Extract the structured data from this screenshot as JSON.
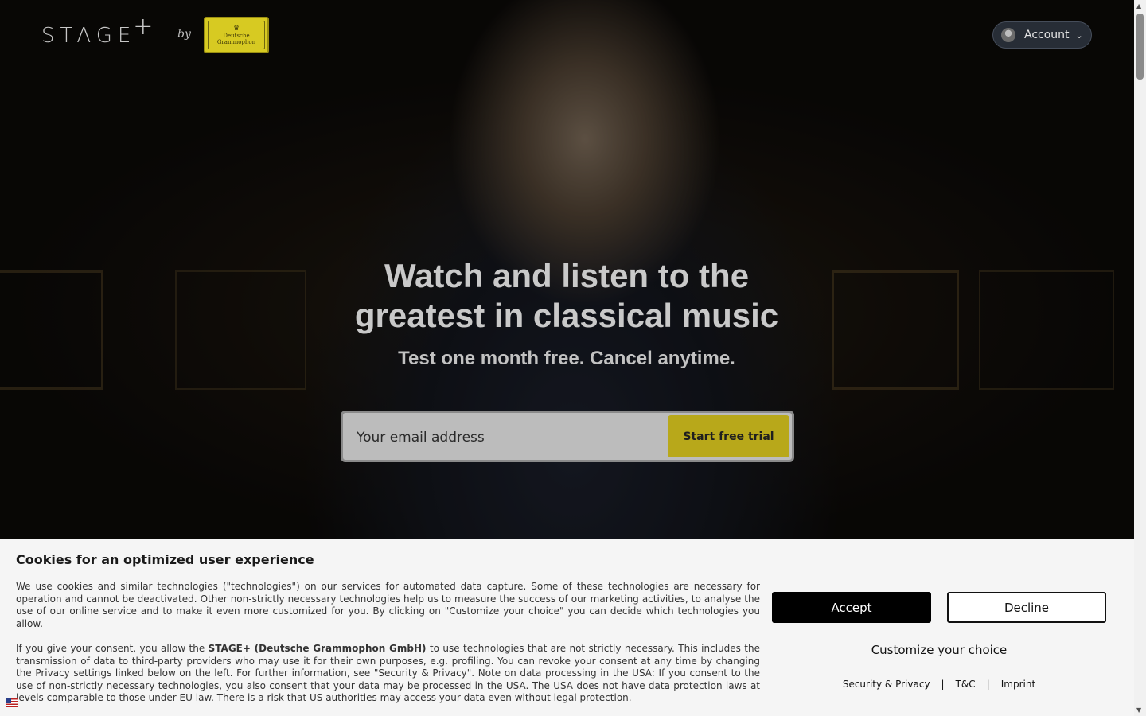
{
  "header": {
    "logo_text": "STAGE",
    "logo_plus": "+",
    "by_text": "by",
    "partner_logo": {
      "line1": "Deutsche",
      "line2": "Grammophon"
    },
    "account_label": "Account"
  },
  "hero": {
    "headline": "Watch and listen to the greatest in classical music",
    "subline": "Test one month free. Cancel anytime.",
    "email_placeholder": "Your email address",
    "cta_label": "Start free trial"
  },
  "cookie_banner": {
    "title": "Cookies for an optimized user experience",
    "paragraph1": "We use cookies and similar technologies (\"technologies\") on our services for automated data capture. Some of these technologies are necessary for operation and cannot be deactivated. Other non-strictly necessary technologies help us to measure the success of our marketing activities, to analyse the use of our online service and to make it even more customized for you. By clicking on \"Customize your choice\" you can decide which technologies you allow.",
    "paragraph2_prefix": "If you give your consent, you allow the ",
    "paragraph2_company": "STAGE+ (Deutsche Grammophon GmbH)",
    "paragraph2_suffix": " to use technologies that are not strictly necessary. This includes the transmission of data to third-party providers who may use it for their own purposes, e.g. profiling. You can revoke your consent at any time by changing the Privacy settings linked below on the left. For further information, see \"Security & Privacy\". Note on data processing in the USA: If you consent to the use of non-strictly necessary technologies, you also consent that your data may be processed in the USA. The USA does not have data protection laws at levels comparable to those under EU law. There is a risk that US authorities may access your data even without legal protection.",
    "accept_label": "Accept",
    "decline_label": "Decline",
    "customize_label": "Customize your choice",
    "links": [
      "Security & Privacy",
      "T&C",
      "Imprint"
    ],
    "separator": "|"
  },
  "colors": {
    "cta": "#b8a81a",
    "accept_bg": "#000000",
    "banner_bg": "#f5f5f5"
  }
}
